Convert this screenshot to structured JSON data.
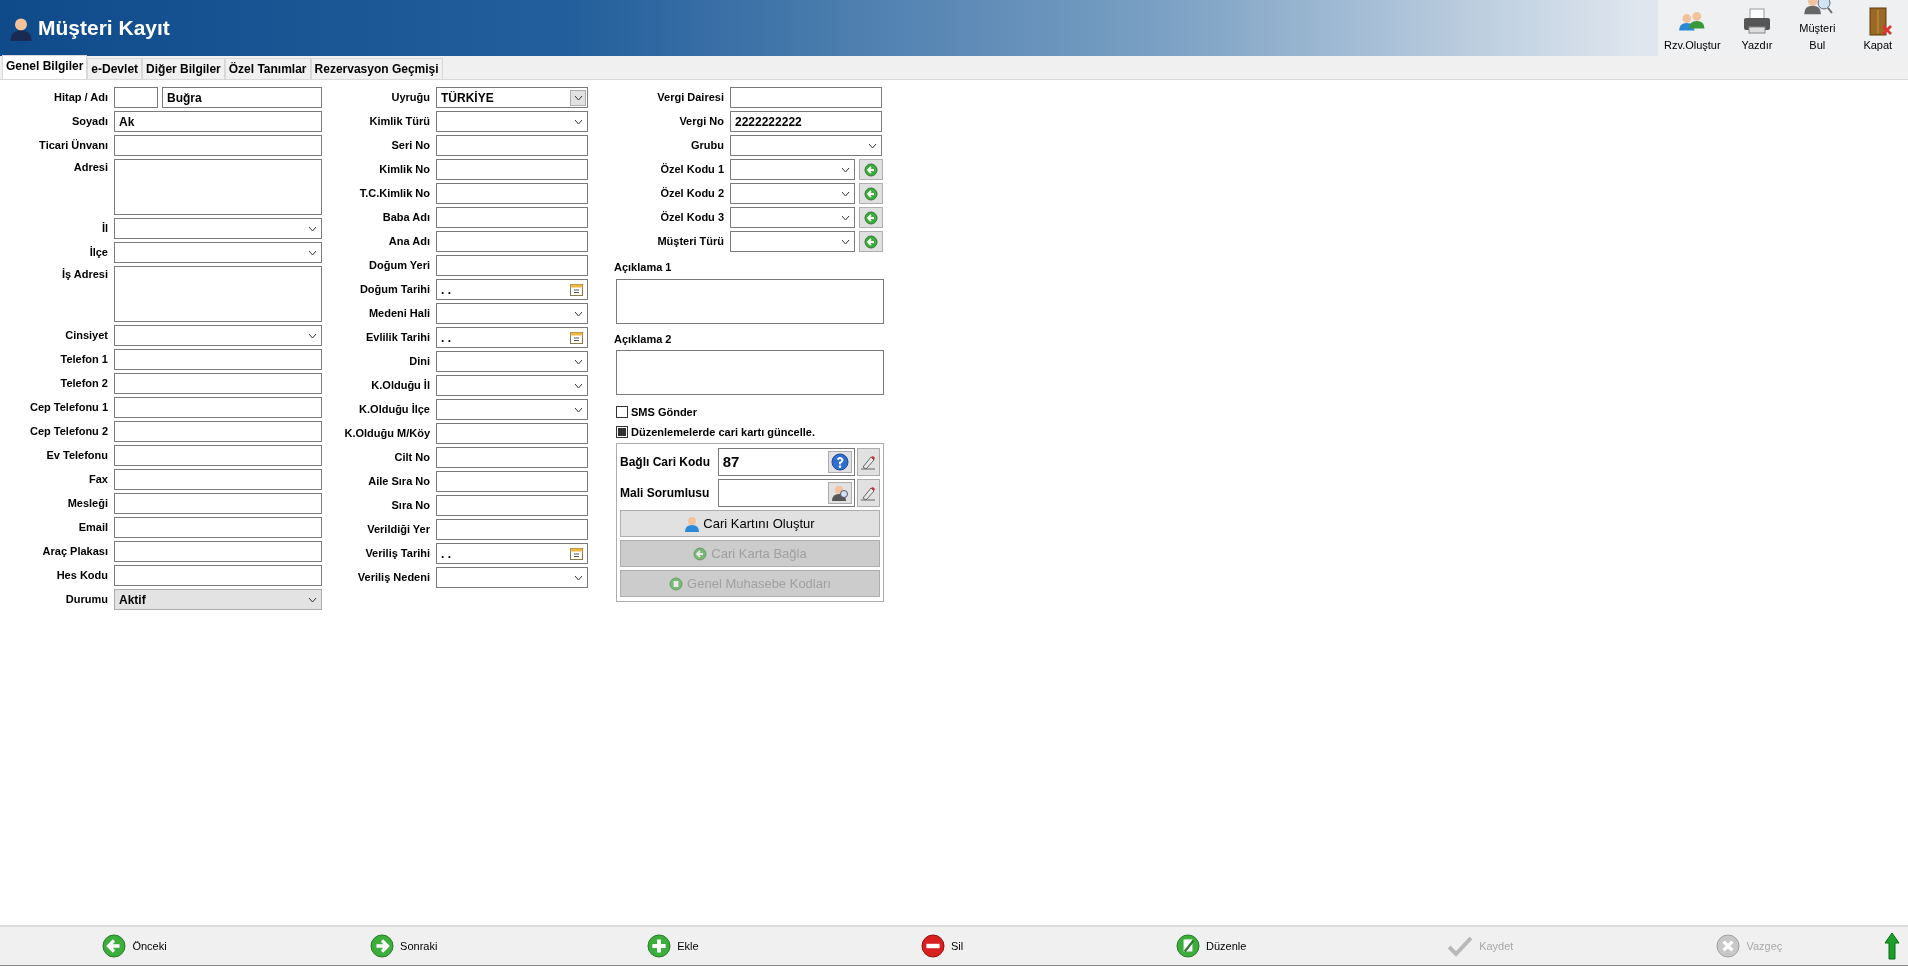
{
  "window": {
    "title": "Müşteri Kayıt"
  },
  "toolbar": [
    {
      "label": "Rzv.Oluştur",
      "kind": "reserve"
    },
    {
      "label": "Yazdır",
      "kind": "print"
    },
    {
      "label": "Müşteri Bul",
      "kind": "find"
    },
    {
      "label": "Kapat",
      "kind": "close"
    }
  ],
  "tabs": [
    {
      "label": "Genel Bilgiler",
      "selected": true
    },
    {
      "label": "e-Devlet",
      "selected": false
    },
    {
      "label": "Diğer Bilgiler",
      "selected": false
    },
    {
      "label": "Özel Tanımlar",
      "selected": false
    },
    {
      "label": "Rezervasyon Geçmişi",
      "selected": false
    }
  ],
  "form": {
    "column_1": [
      {
        "label": "Hitap / Adı",
        "kind": "pair",
        "value": "Buğra"
      },
      {
        "label": "Soyadı",
        "kind": "text",
        "value": "Ak"
      },
      {
        "label": "Ticari Ünvanı",
        "kind": "text"
      },
      {
        "label": "Adresi",
        "kind": "memo"
      },
      {
        "label": "İl",
        "kind": "select"
      },
      {
        "label": "İlçe",
        "kind": "select"
      },
      {
        "label": "İş Adresi",
        "kind": "memo"
      },
      {
        "label": "Cinsiyet",
        "kind": "select"
      },
      {
        "label": "Telefon 1",
        "kind": "text"
      },
      {
        "label": "Telefon 2",
        "kind": "text"
      },
      {
        "label": "Cep Telefonu 1",
        "kind": "text"
      },
      {
        "label": "Cep Telefonu 2",
        "kind": "text"
      },
      {
        "label": "Ev Telefonu",
        "kind": "text"
      },
      {
        "label": "Fax",
        "kind": "text"
      },
      {
        "label": "Mesleği",
        "kind": "text"
      },
      {
        "label": "Email",
        "kind": "text"
      },
      {
        "label": "Araç Plakası",
        "kind": "text"
      },
      {
        "label": "Hes Kodu",
        "kind": "text"
      },
      {
        "label": "Durumu",
        "kind": "list",
        "value": "Aktif"
      }
    ],
    "column_2": [
      {
        "label": "Uyruğu",
        "kind": "combo",
        "value": "TÜRKİYE"
      },
      {
        "label": "Kimlik Türü",
        "kind": "select"
      },
      {
        "label": "Seri No",
        "kind": "text"
      },
      {
        "label": "Kimlik No",
        "kind": "text"
      },
      {
        "label": "T.C.Kimlik No",
        "kind": "text"
      },
      {
        "label": "Baba Adı",
        "kind": "text"
      },
      {
        "label": "Ana Adı",
        "kind": "text"
      },
      {
        "label": "Doğum Yeri",
        "kind": "text"
      },
      {
        "label": "Doğum Tarihi",
        "kind": "date",
        "value": ". ."
      },
      {
        "label": "Medeni Hali",
        "kind": "select"
      },
      {
        "label": "Evlilik Tarihi",
        "kind": "date",
        "value": ". ."
      },
      {
        "label": "Dini",
        "kind": "select"
      },
      {
        "label": "K.Olduğu İl",
        "kind": "select"
      },
      {
        "label": "K.Olduğu İlçe",
        "kind": "select"
      },
      {
        "label": "K.Olduğu M/Köy",
        "kind": "text"
      },
      {
        "label": "Cilt No",
        "kind": "text"
      },
      {
        "label": "Aile Sıra No",
        "kind": "text"
      },
      {
        "label": "Sıra No",
        "kind": "text"
      },
      {
        "label": "Verildiği Yer",
        "kind": "text"
      },
      {
        "label": "Veriliş Tarihi",
        "kind": "date",
        "value": ". ."
      },
      {
        "label": "Veriliş Nedeni",
        "kind": "select"
      }
    ],
    "column_3": [
      {
        "label": "Vergi Dairesi",
        "kind": "text"
      },
      {
        "label": "Vergi No",
        "kind": "text",
        "value": "2222222222"
      },
      {
        "label": "Grubu",
        "kind": "select"
      },
      {
        "label": "Özel Kodu 1",
        "kind": "select-add"
      },
      {
        "label": "Özel Kodu 2",
        "kind": "select-add"
      },
      {
        "label": "Özel Kodu 3",
        "kind": "select-add"
      },
      {
        "label": "Müşteri Türü",
        "kind": "select-add"
      }
    ]
  },
  "notes": [
    {
      "label": "Açıklama 1"
    },
    {
      "label": "Açıklama 2"
    }
  ],
  "checkboxes": [
    {
      "label": "SMS Gönder",
      "checked": false
    },
    {
      "label": "Düzenlemelerde cari kartı güncelle.",
      "checked": true
    }
  ],
  "link_panel": {
    "fields": [
      {
        "label": "Bağlı Cari Kodu",
        "kind": "help",
        "value": "87"
      },
      {
        "label": "Mali Sorumlusu",
        "kind": "person"
      }
    ],
    "buttons": [
      {
        "label": "Cari Kartını Oluştur",
        "kind": "create",
        "disabled": false
      },
      {
        "label": "Cari Karta Bağla",
        "kind": "link",
        "disabled": true
      },
      {
        "label": "Genel Muhasebe Kodları",
        "kind": "ledger",
        "disabled": true
      }
    ]
  },
  "bottom_bar": [
    {
      "label": "Önceki",
      "kind": "prev",
      "disabled": false
    },
    {
      "label": "Sonraki",
      "kind": "next",
      "disabled": false
    },
    {
      "label": "Ekle",
      "kind": "add",
      "disabled": false
    },
    {
      "label": "Sil",
      "kind": "delete",
      "disabled": false
    },
    {
      "label": "Düzenle",
      "kind": "edit",
      "disabled": false
    },
    {
      "label": "Kaydet",
      "kind": "save",
      "disabled": true
    },
    {
      "label": "Vazgeç",
      "kind": "cancel",
      "disabled": true
    }
  ]
}
